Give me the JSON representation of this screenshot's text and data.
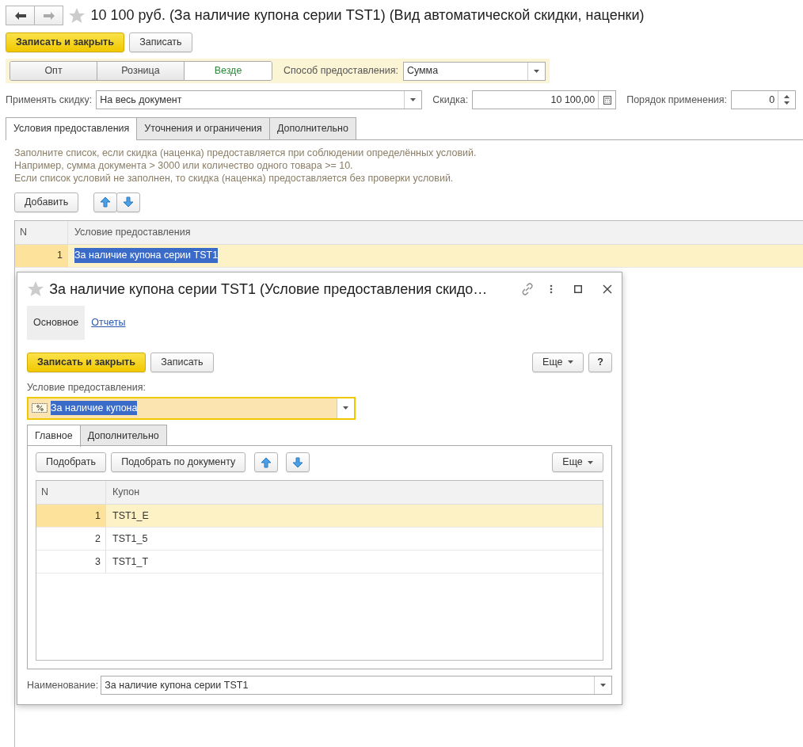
{
  "window": {
    "title": "10 100 руб. (За наличие купона серии TST1) (Вид автоматической скидки, наценки)",
    "favorite": false
  },
  "toolbar": [
    {
      "label": "Записать и закрыть",
      "kind": "primary"
    },
    {
      "label": "Записать",
      "kind": "default"
    }
  ],
  "scope_switch": [
    {
      "label": "Опт",
      "selected": false
    },
    {
      "label": "Розница",
      "selected": false
    },
    {
      "label": "Везде",
      "selected": true
    }
  ],
  "method": {
    "label": "Способ предоставления:",
    "value": "Сумма"
  },
  "apply": {
    "label": "Применять скидку:",
    "value": "На весь документ"
  },
  "discount": {
    "label": "Скидка:",
    "value": "10 100,00"
  },
  "order": {
    "label": "Порядок применения:",
    "value": "0"
  },
  "tabs": [
    {
      "label": "Условия предоставления",
      "selected": true
    },
    {
      "label": "Уточнения и ограничения",
      "selected": false
    },
    {
      "label": "Дополнительно",
      "selected": false
    }
  ],
  "hint_lines": [
    "Заполните список, если скидка (наценка) предоставляется при соблюдении определённых условий.",
    "Например, сумма документа > 3000 или количество одного товара >= 10.",
    "Если список условий не заполнен, то скидка (наценка) предоставляется без проверки условий."
  ],
  "add_button": "Добавить",
  "table": {
    "columns": [
      "N",
      "Условие предоставления"
    ],
    "rows": [
      {
        "n": "1",
        "condition": "За наличие купона серии TST1",
        "selected": true
      }
    ]
  },
  "dialog": {
    "title": "За наличие купона серии TST1 (Условие предоставления скидо…",
    "favorite": false,
    "nav": [
      {
        "label": "Основное",
        "selected": true
      },
      {
        "label": "Отчеты",
        "selected": false
      }
    ],
    "toolbar": [
      {
        "label": "Записать и закрыть",
        "kind": "primary"
      },
      {
        "label": "Записать",
        "kind": "default"
      }
    ],
    "more_button": "Еще",
    "help_button": "?",
    "condition": {
      "label": "Условие предоставления:",
      "value": "За наличие купона"
    },
    "tabs": [
      {
        "label": "Главное",
        "selected": true
      },
      {
        "label": "Дополнительно",
        "selected": false
      }
    ],
    "pick_buttons": [
      "Подобрать",
      "Подобрать по документу"
    ],
    "table_more_button": "Еще",
    "table": {
      "columns": [
        "N",
        "Купон"
      ],
      "rows": [
        {
          "n": "1",
          "coupon": "TST1_E",
          "selected": true
        },
        {
          "n": "2",
          "coupon": "TST1_5",
          "selected": false
        },
        {
          "n": "3",
          "coupon": "TST1_T",
          "selected": false
        }
      ]
    },
    "name": {
      "label": "Наименование:",
      "value": "За наличие купона серии TST1"
    }
  }
}
